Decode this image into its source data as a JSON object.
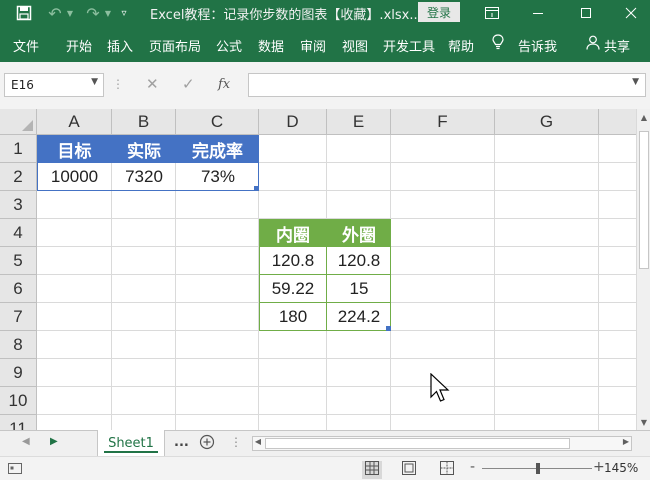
{
  "window": {
    "title": "Excel教程：记录你步数的图表【收藏】.xlsx...",
    "login_label": "登录"
  },
  "ribbon": {
    "tabs": [
      "文件",
      "开始",
      "插入",
      "页面布局",
      "公式",
      "数据",
      "审阅",
      "视图",
      "开发工具",
      "帮助"
    ],
    "tell_me": "告诉我",
    "share": "共享"
  },
  "formula_bar": {
    "name_box": "E16",
    "formula": "",
    "fx_label": "fx"
  },
  "grid": {
    "columns": [
      "A",
      "B",
      "C",
      "D",
      "E",
      "F",
      "G"
    ],
    "rows": [
      "1",
      "2",
      "3",
      "4",
      "5",
      "6",
      "7",
      "8",
      "9",
      "10",
      "11"
    ],
    "selected_column": "E",
    "selected_row": "16"
  },
  "table1": {
    "headers": [
      "目标",
      "实际",
      "完成率"
    ],
    "row": [
      "10000",
      "7320",
      "73%"
    ],
    "color": "#4472C4"
  },
  "table2": {
    "headers": [
      "内圈",
      "外圈"
    ],
    "rows": [
      [
        "120.8",
        "120.8"
      ],
      [
        "59.22",
        "15"
      ],
      [
        "180",
        "224.2"
      ]
    ],
    "color": "#70AD47"
  },
  "sheets": {
    "active": "Sheet1",
    "more": "..."
  },
  "status": {
    "zoom": "145%",
    "zoom_minus": "-",
    "zoom_plus": "+"
  },
  "theme": {
    "excel_green": "#217346"
  }
}
